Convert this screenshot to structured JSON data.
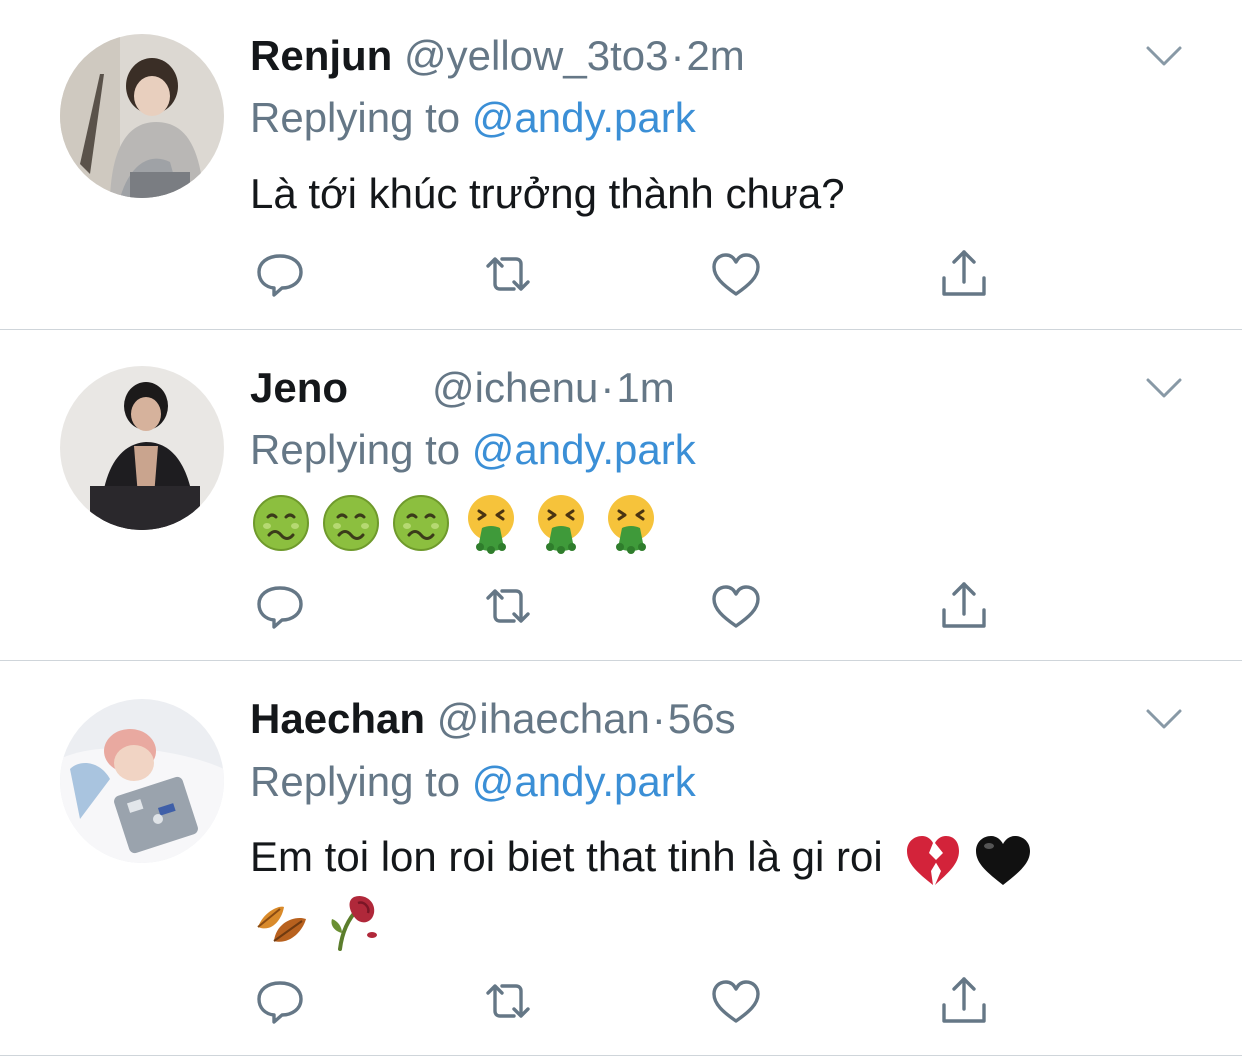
{
  "tweets": [
    {
      "name": "Renjun",
      "handle": "@yellow_3to3",
      "separator": "·",
      "time": "2m",
      "reply_label": "Replying to",
      "reply_target": "@andy.park",
      "text": "Là tới khúc trưởng thành chưa?",
      "emojis": []
    },
    {
      "name": "Jeno",
      "handle": "@ichenu",
      "separator": "·",
      "time": "1m",
      "reply_label": "Replying to",
      "reply_target": "@andy.park",
      "text": "",
      "emojis": [
        "nauseated-face-emoji",
        "nauseated-face-emoji",
        "nauseated-face-emoji",
        "vomiting-face-emoji",
        "vomiting-face-emoji",
        "vomiting-face-emoji"
      ]
    },
    {
      "name": "Haechan",
      "handle": "@ihaechan",
      "separator": "·",
      "time": "56s",
      "reply_label": "Replying to",
      "reply_target": "@andy.park",
      "text": "Em toi lon roi biet that tinh là gi roi",
      "emojis": [
        "broken-heart-emoji",
        "black-heart-emoji",
        "fallen-leaf-emoji",
        "wilted-flower-emoji"
      ]
    }
  ],
  "icons": {
    "reply": "reply-icon",
    "retweet": "retweet-icon",
    "like": "like-icon",
    "share": "share-icon",
    "more": "chevron-down-icon"
  },
  "colors": {
    "link": "#3b8fd6",
    "secondary": "#657786",
    "icon": "#657786",
    "divider": "#cfd5da"
  }
}
